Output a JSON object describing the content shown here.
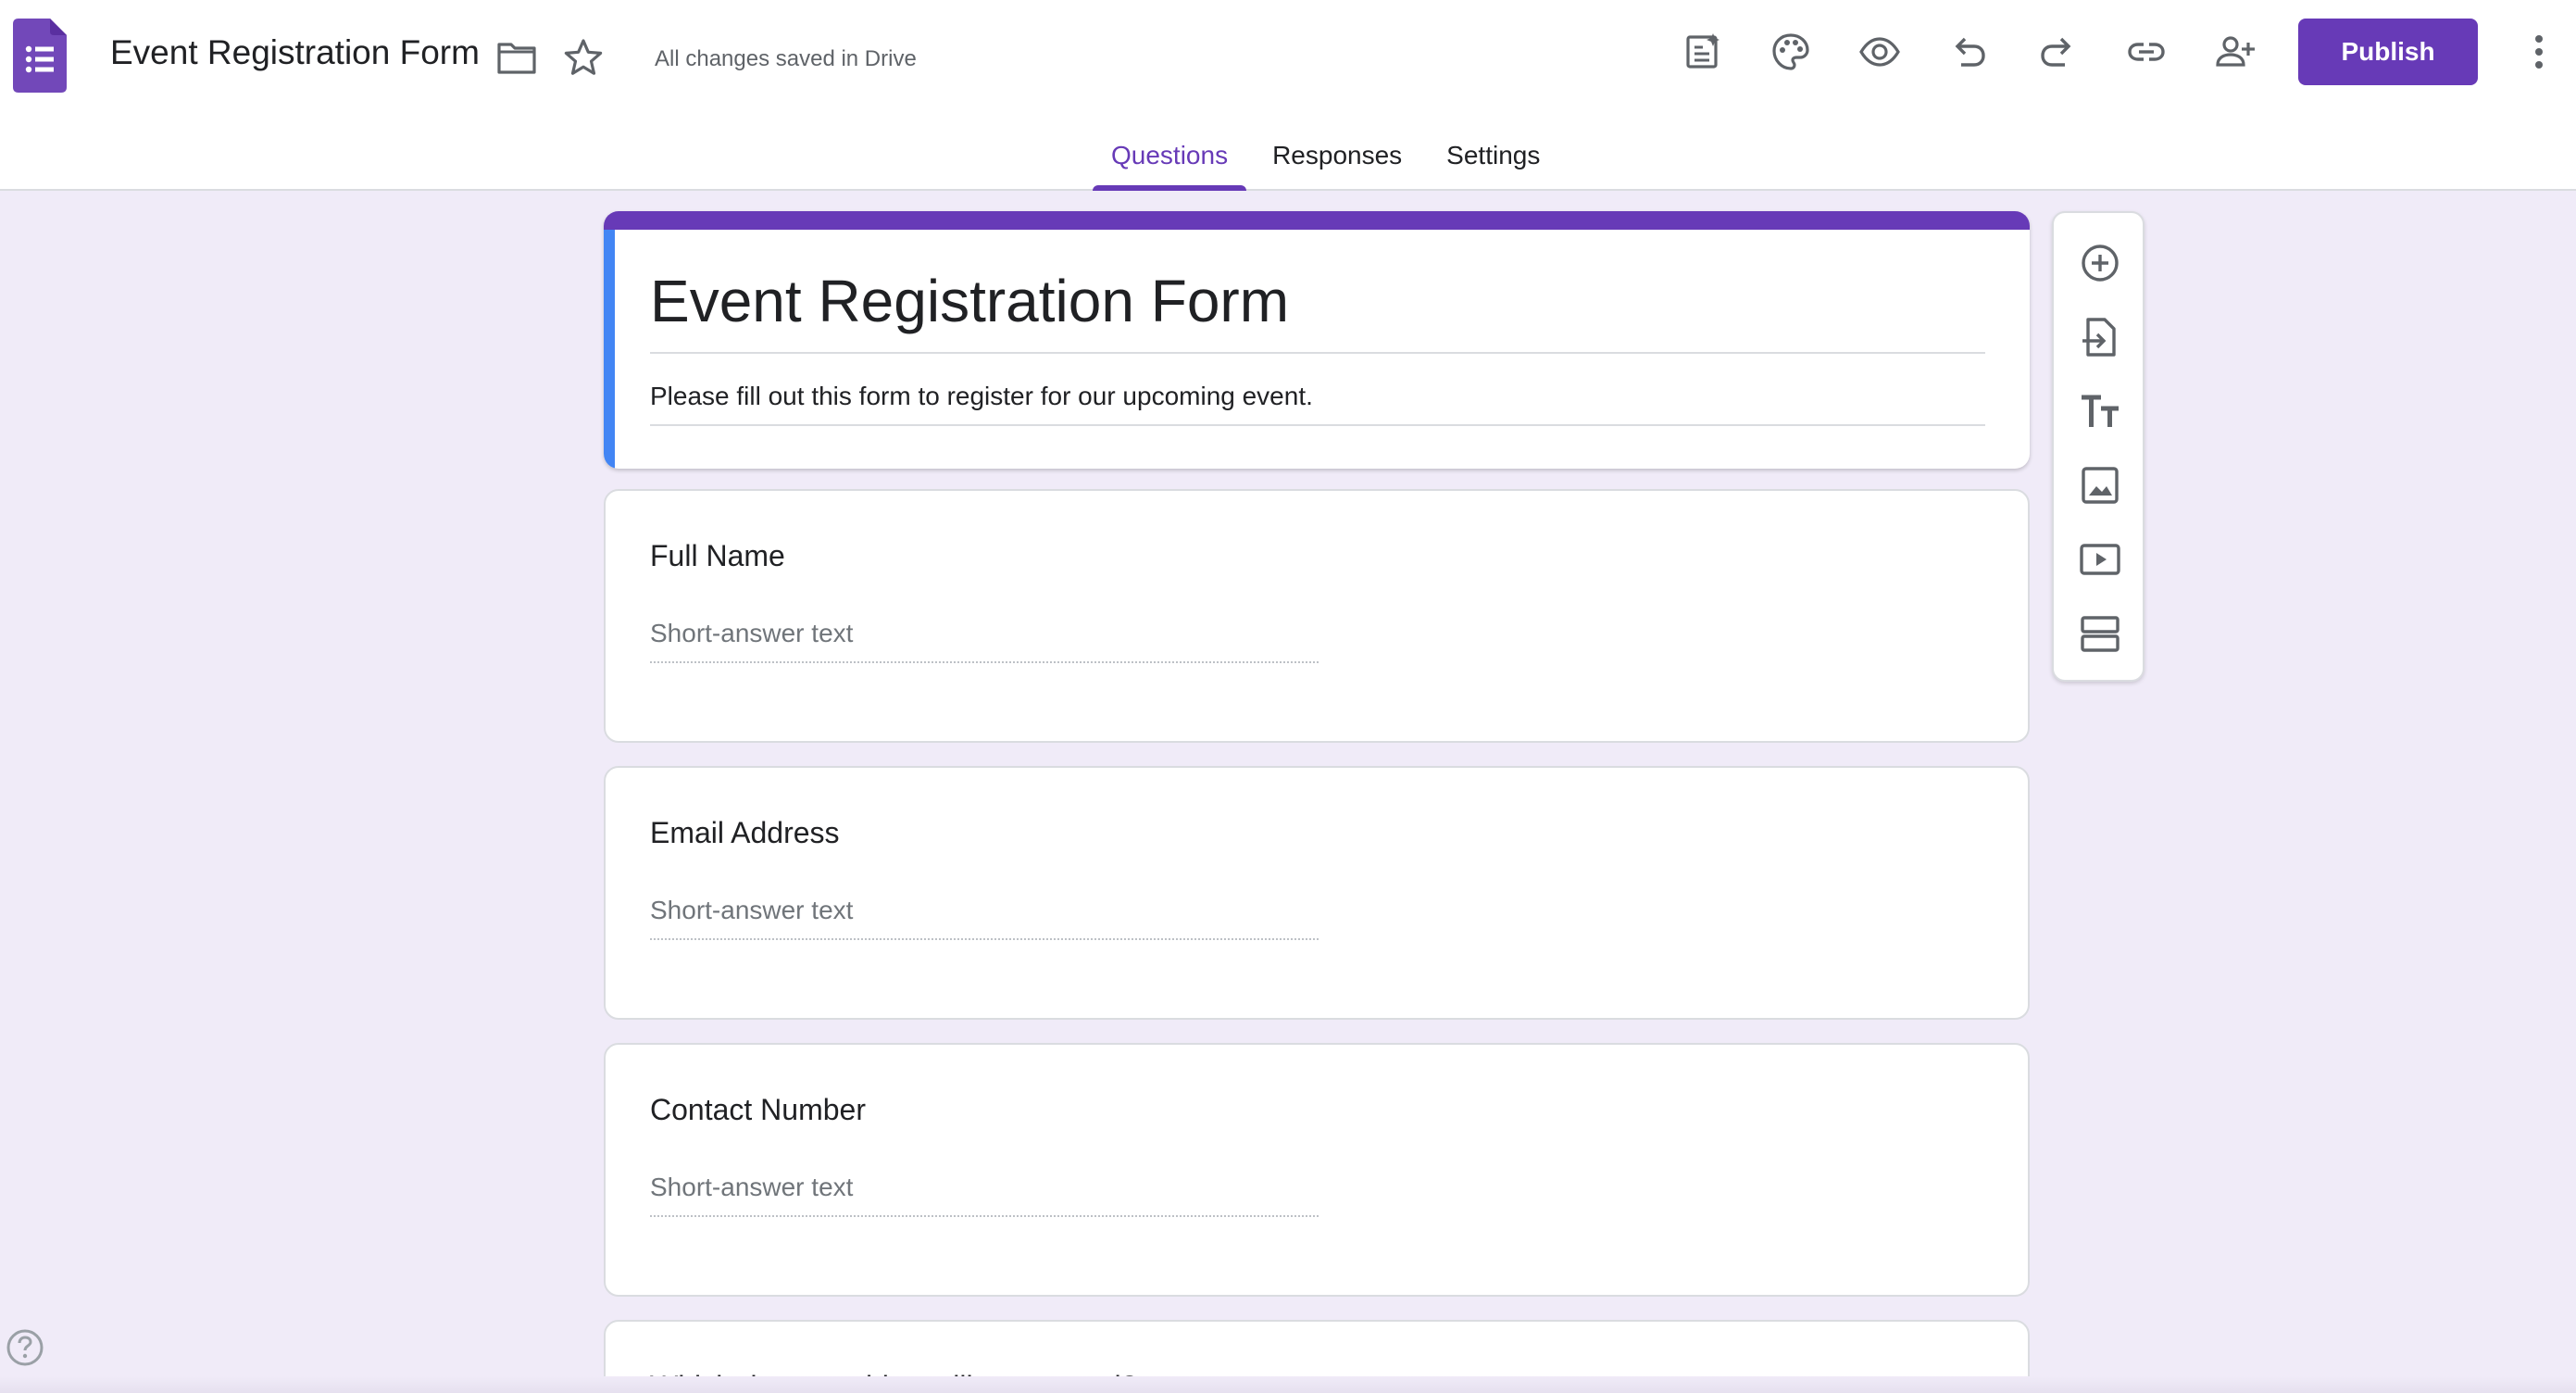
{
  "header": {
    "title": "Event Registration Form",
    "save_status": "All changes saved in Drive",
    "publish_label": "Publish"
  },
  "tabs": [
    {
      "label": "Questions",
      "active": true
    },
    {
      "label": "Responses",
      "active": false
    },
    {
      "label": "Settings",
      "active": false
    }
  ],
  "form": {
    "title": "Event Registration Form",
    "description": "Please fill out this form to register for our upcoming event.",
    "questions": [
      {
        "title": "Full Name",
        "answer_placeholder": "Short-answer text"
      },
      {
        "title": "Email Address",
        "answer_placeholder": "Short-answer text"
      },
      {
        "title": "Contact Number",
        "answer_placeholder": "Short-answer text"
      }
    ],
    "partial_question": "Which days would you like to attend?"
  },
  "colors": {
    "accent": "#673ab7",
    "background": "#f0ebf8",
    "title_band_left": "#4285f4"
  },
  "icons": {
    "header_tools": [
      "ai-assist-icon",
      "palette-icon",
      "preview-eye-icon",
      "undo-icon",
      "redo-icon",
      "link-icon",
      "add-collaborator-icon"
    ],
    "floating_toolbar": [
      "add-question-icon",
      "import-questions-icon",
      "add-title-icon",
      "add-image-icon",
      "add-video-icon",
      "add-section-icon"
    ]
  }
}
